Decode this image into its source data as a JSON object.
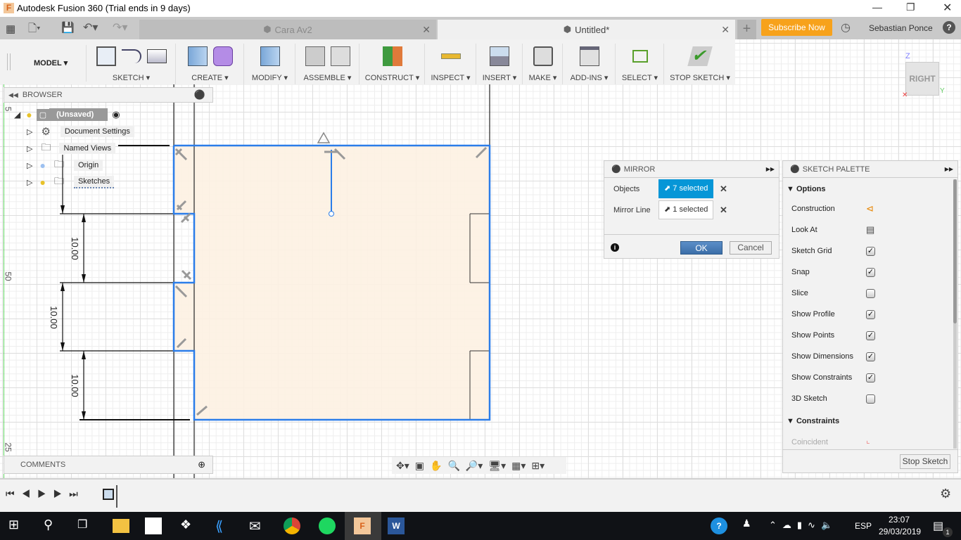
{
  "window": {
    "title": "Autodesk Fusion 360 (Trial ends in 9 days)"
  },
  "tabs": [
    {
      "label": "Cara Av2",
      "active": false
    },
    {
      "label": "Untitled*",
      "active": true
    }
  ],
  "header": {
    "subscribe": "Subscribe Now",
    "user": "Sebastian Ponce",
    "accent": "#f7a21b"
  },
  "toolbar": {
    "workspace": "MODEL",
    "groups": [
      "SKETCH",
      "CREATE",
      "MODIFY",
      "ASSEMBLE",
      "CONSTRUCT",
      "INSPECT",
      "INSERT",
      "MAKE",
      "ADD-INS",
      "SELECT",
      "STOP SKETCH"
    ]
  },
  "browser": {
    "title": "BROWSER",
    "root": "(Unsaved)",
    "items": [
      "Document Settings",
      "Named Views",
      "Origin",
      "Sketches"
    ]
  },
  "comments": {
    "title": "COMMENTS"
  },
  "ruler": [
    "5",
    "50",
    "25"
  ],
  "dimensions": [
    "10.00",
    "10.00",
    "10.00"
  ],
  "viewcube": {
    "face": "RIGHT",
    "z": "Z",
    "y": "Y"
  },
  "mirror": {
    "title": "MIRROR",
    "objects_label": "Objects",
    "objects_value": "7 selected",
    "line_label": "Mirror Line",
    "line_value": "1 selected",
    "ok": "OK",
    "cancel": "Cancel"
  },
  "palette": {
    "title": "SKETCH PALETTE",
    "options_header": "Options",
    "options": [
      {
        "label": "Construction",
        "type": "icon"
      },
      {
        "label": "Look At",
        "type": "icon"
      },
      {
        "label": "Sketch Grid",
        "checked": true
      },
      {
        "label": "Snap",
        "checked": true
      },
      {
        "label": "Slice",
        "checked": false
      },
      {
        "label": "Show Profile",
        "checked": true
      },
      {
        "label": "Show Points",
        "checked": true
      },
      {
        "label": "Show Dimensions",
        "checked": true
      },
      {
        "label": "Show Constraints",
        "checked": true
      },
      {
        "label": "3D Sketch",
        "checked": false
      }
    ],
    "constraints_header": "Constraints",
    "constraint_first": "Coincident",
    "stop": "Stop Sketch"
  },
  "taskbar": {
    "time": "23:07",
    "date": "29/03/2019",
    "lang": "ESP",
    "notifications": "1"
  }
}
